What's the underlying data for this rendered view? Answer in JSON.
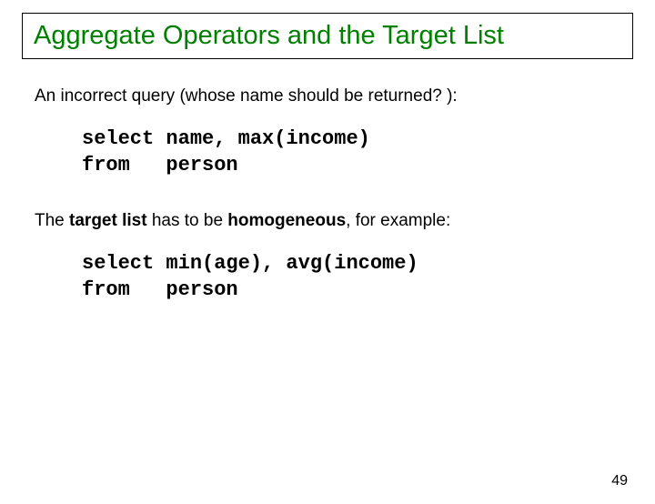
{
  "title": "Aggregate Operators and the Target List",
  "para1_pre": "An incorrect query (whose ",
  "para1_bold": "name",
  "para1_post": " should be returned? ):",
  "code1": "select name, max(income)\nfrom   person",
  "para2_pre": "The ",
  "para2_b1": "target list",
  "para2_mid": " has to be ",
  "para2_b2": "homogeneous",
  "para2_post": ", for example:",
  "code2": "select min(age), avg(income)\nfrom   person",
  "pageNumber": "49"
}
